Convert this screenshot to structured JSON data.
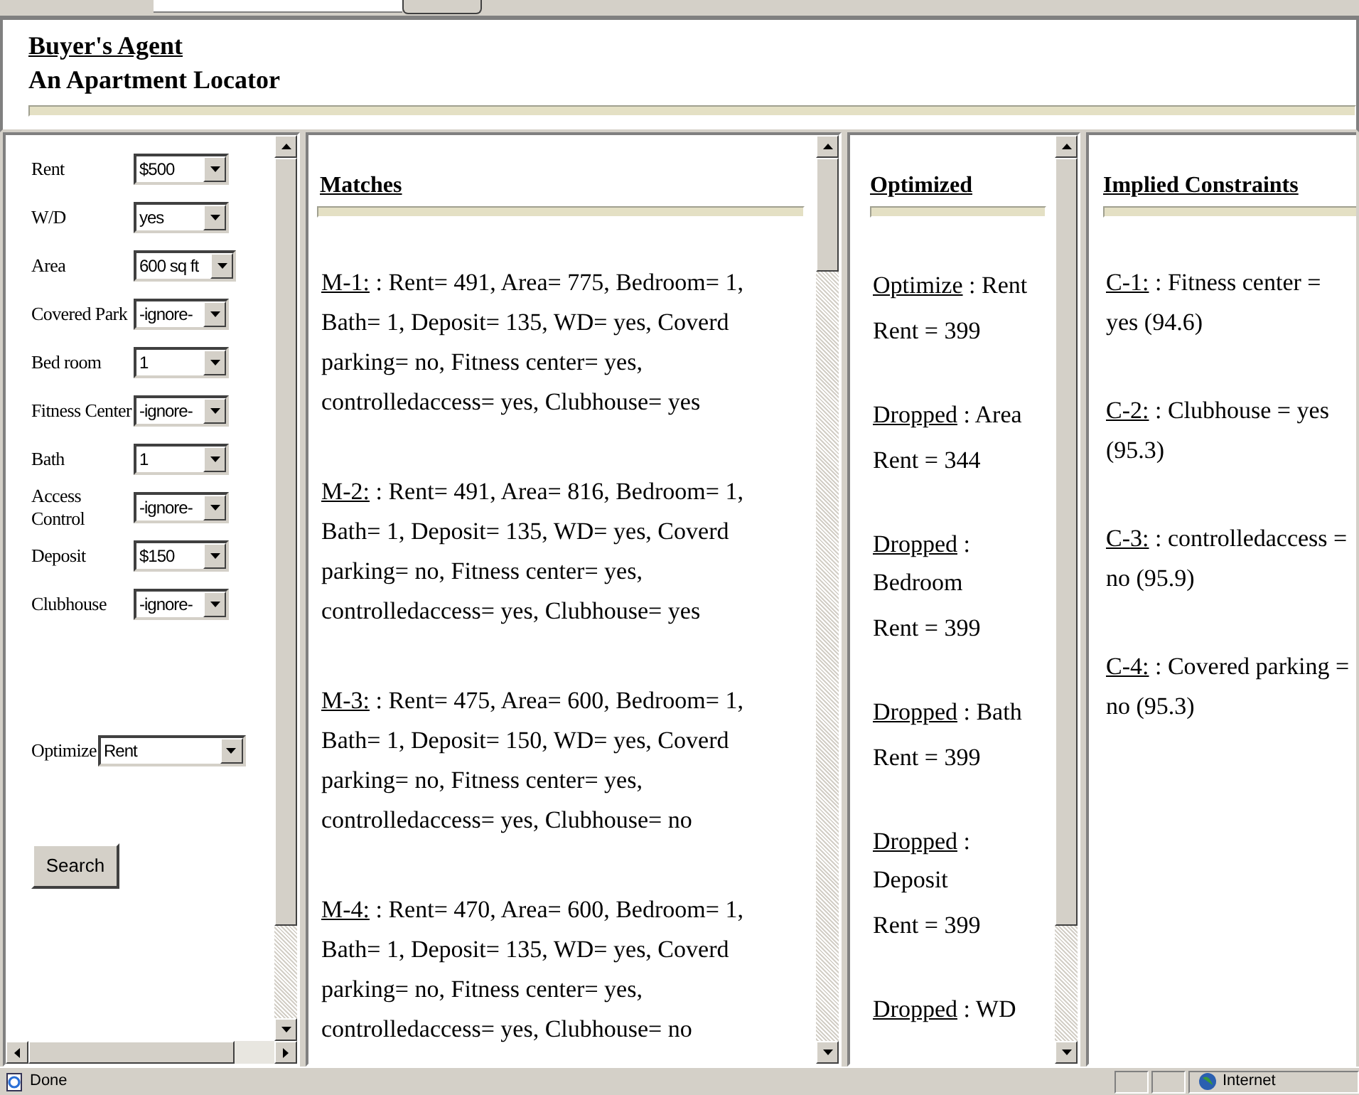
{
  "header": {
    "title": "Buyer's Agent",
    "subtitle": "An Apartment Locator"
  },
  "filters": [
    {
      "label": "Rent",
      "value": "$500"
    },
    {
      "label": "W/D",
      "value": "yes"
    },
    {
      "label": "Area",
      "value": "600 sq ft"
    },
    {
      "label": "Covered Park",
      "value": "-ignore-"
    },
    {
      "label": "Bed room",
      "value": "1"
    },
    {
      "label": "Fitness Center",
      "value": "-ignore-"
    },
    {
      "label": "Bath",
      "value": "1"
    },
    {
      "label": "Access Control",
      "value": "-ignore-"
    },
    {
      "label": "Deposit",
      "value": "$150"
    },
    {
      "label": "Clubhouse",
      "value": "-ignore-"
    }
  ],
  "optimize": {
    "label": "Optimize",
    "value": "Rent"
  },
  "search_button": "Search",
  "matches": {
    "title": "Matches",
    "items": [
      {
        "id": "M-1:",
        "text": " : Rent= 491, Area= 775, Bedroom= 1, Bath= 1, Deposit= 135, WD= yes, Coverd parking= no, Fitness center= yes, controlledaccess= yes, Clubhouse= yes"
      },
      {
        "id": "M-2:",
        "text": " : Rent= 491, Area= 816, Bedroom= 1, Bath= 1, Deposit= 135, WD= yes, Coverd parking= no, Fitness center= yes, controlledaccess= yes, Clubhouse= yes"
      },
      {
        "id": "M-3:",
        "text": " : Rent= 475, Area= 600, Bedroom= 1, Bath= 1, Deposit= 150, WD= yes, Coverd parking= no, Fitness center= yes, controlledaccess= yes, Clubhouse= no"
      },
      {
        "id": "M-4:",
        "text": " : Rent= 470, Area= 600, Bedroom= 1, Bath= 1, Deposit= 135, WD= yes, Coverd parking= no, Fitness center= yes, controlledaccess= yes, Clubhouse= no"
      }
    ]
  },
  "optimized": {
    "title": "Optimized",
    "items": [
      {
        "link": "Optimize",
        "text": " : Rent",
        "result": "Rent = 399"
      },
      {
        "link": "Dropped",
        "text": " : Area",
        "result": "Rent = 344"
      },
      {
        "link": "Dropped",
        "text": " : Bedroom",
        "result": "Rent = 399"
      },
      {
        "link": "Dropped",
        "text": " : Bath",
        "result": "Rent = 399"
      },
      {
        "link": "Dropped",
        "text": " : Deposit",
        "result": "Rent = 399"
      },
      {
        "link": "Dropped",
        "text": " : WD"
      }
    ]
  },
  "constraints": {
    "title": "Implied Constraints",
    "items": [
      {
        "id": "C-1:",
        "text": " : Fitness center = yes (94.6)"
      },
      {
        "id": "C-2:",
        "text": " : Clubhouse = yes (95.3)"
      },
      {
        "id": "C-3:",
        "text": " : controlledaccess = no (95.9)"
      },
      {
        "id": "C-4:",
        "text": " : Covered parking = no (95.3)"
      }
    ]
  },
  "status_bar": {
    "text": "Done",
    "zone": "Internet"
  }
}
